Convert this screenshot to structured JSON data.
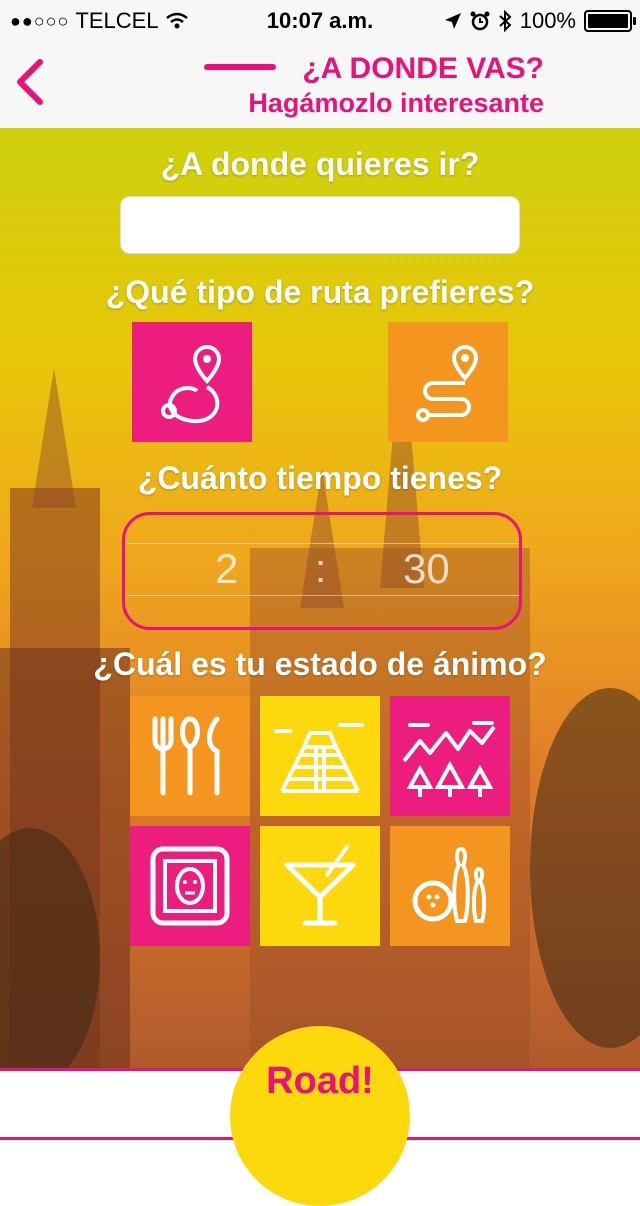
{
  "status_bar": {
    "signal": "●●○○○",
    "carrier": "TELCEL",
    "time": "10:07 a.m.",
    "battery": "100%"
  },
  "nav": {
    "back_icon": "chevron-left-icon",
    "title": "¿A DONDE VAS?",
    "subtitle": "Hagámozlo interesante"
  },
  "form": {
    "destination_label": "¿A donde quieres ir?",
    "destination_value": "",
    "route_label": "¿Qué tipo de ruta prefieres?",
    "route_types": [
      {
        "icon": "loop-route-icon",
        "color": "#ed1d7f"
      },
      {
        "icon": "zigzag-route-icon",
        "color": "#f4951f"
      }
    ],
    "time_label": "¿Cuánto tiempo tienes?",
    "time_hours": "2",
    "time_sep": ":",
    "time_minutes": "30",
    "mood_label": "¿Cuál es tu estado de ánimo?",
    "moods": [
      {
        "icon": "dining-icon",
        "color": "#f4951f"
      },
      {
        "icon": "pyramid-icon",
        "color": "#fcd80d"
      },
      {
        "icon": "nature-icon",
        "color": "#ed1d7f"
      },
      {
        "icon": "art-frame-icon",
        "color": "#ed1d7f"
      },
      {
        "icon": "cocktail-icon",
        "color": "#fcd80d"
      },
      {
        "icon": "bowling-icon",
        "color": "#f4951f"
      }
    ]
  },
  "action": {
    "go_label": "Road!"
  },
  "colors": {
    "accent": "#e8127a",
    "yellow": "#fcd80d",
    "orange": "#f4951f"
  }
}
